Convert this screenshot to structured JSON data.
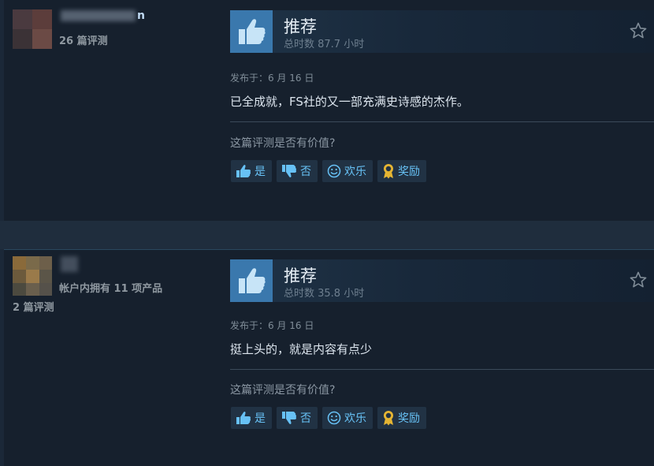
{
  "reviews": [
    {
      "username_suffix": "n",
      "user_line1": "26 篇评测",
      "user_line2": "",
      "vote_label": "推荐",
      "hours": "总时数 87.7 小时",
      "posted": "发布于：6 月 16 日",
      "content": "已全成就，FS社的又一部充满史诗感的杰作。",
      "helpful_prompt": "这篇评测是否有价值?",
      "buttons": {
        "yes": "是",
        "no": "否",
        "funny": "欢乐",
        "award": "奖励"
      }
    },
    {
      "username_suffix": "",
      "user_line1": "帐户内拥有 11 项产品",
      "user_line2": "2 篇评测",
      "vote_label": "推荐",
      "hours": "总时数 35.8 小时",
      "posted": "发布于：6 月 16 日",
      "content": "挺上头的，就是内容有点少",
      "helpful_prompt": "这篇评测是否有价值?",
      "buttons": {
        "yes": "是",
        "no": "否",
        "funny": "欢乐",
        "award": "奖励"
      }
    }
  ],
  "colors": {
    "accent": "#67c1f5",
    "thumb_box": "#3a78ad",
    "panel": "#16202d",
    "page_bg": "#1b2838"
  },
  "icons": {
    "vote": "thumbs-up-icon",
    "favorite": "star-icon",
    "yes": "thumbs-up-icon",
    "no": "thumbs-down-icon",
    "funny": "smiley-icon",
    "award": "award-ribbon-icon"
  }
}
